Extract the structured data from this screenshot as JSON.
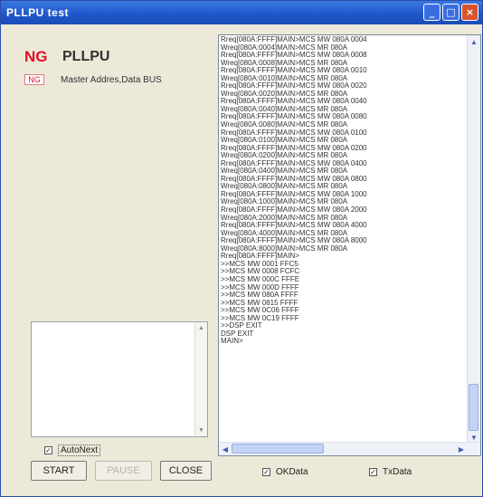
{
  "window": {
    "title": "PLLPU test",
    "controls": {
      "minimize": "_",
      "maximize": "□",
      "close": "×"
    }
  },
  "status": {
    "main_result": "NG",
    "main_title": "PLLPU",
    "sub_result": "NG",
    "sub_label": "Master Addres,Data BUS"
  },
  "controls": {
    "autonext_label": "AutoNext",
    "autonext_checked": true,
    "start_label": "START",
    "pause_label": "PAUSE",
    "pause_enabled": false,
    "close_label": "CLOSE",
    "okdata_label": "OKData",
    "okdata_checked": true,
    "txdata_label": "TxData",
    "txdata_checked": true
  },
  "log": {
    "lines": [
      "Rreq[080A:FFFF]MAIN>MCS MW 080A 0004",
      "Wreq[080A:0004]MAIN>MCS MR 080A",
      "Rreq[080A:FFFF]MAIN>MCS MW 080A 0008",
      "Wreq[080A:0008]MAIN>MCS MR 080A",
      "Rreq[080A:FFFF]MAIN>MCS MW 080A 0010",
      "Wreq[080A:0010]MAIN>MCS MR 080A",
      "Rreq[080A:FFFF]MAIN>MCS MW 080A 0020",
      "Wreq[080A:0020]MAIN>MCS MR 080A",
      "Rreq[080A:FFFF]MAIN>MCS MW 080A 0040",
      "Wreq[080A:0040]MAIN>MCS MR 080A",
      "Rreq[080A:FFFF]MAIN>MCS MW 080A 0080",
      "Wreq[080A:0080]MAIN>MCS MR 080A",
      "Rreq[080A:FFFF]MAIN>MCS MW 080A 0100",
      "Wreq[080A:0100]MAIN>MCS MR 080A",
      "Rreq[080A:FFFF]MAIN>MCS MW 080A 0200",
      "Wreq[080A:0200]MAIN>MCS MR 080A",
      "Rreq[080A:FFFF]MAIN>MCS MW 080A 0400",
      "Wreq[080A:0400]MAIN>MCS MR 080A",
      "Rreq[080A:FFFF]MAIN>MCS MW 080A 0800",
      "Wreq[080A:0800]MAIN>MCS MR 080A",
      "Rreq[080A:FFFF]MAIN>MCS MW 080A 1000",
      "Wreq[080A:1000]MAIN>MCS MR 080A",
      "Rreq[080A:FFFF]MAIN>MCS MW 080A 2000",
      "Wreq[080A:2000]MAIN>MCS MR 080A",
      "Rreq[080A:FFFF]MAIN>MCS MW 080A 4000",
      "Wreq[080A:4000]MAIN>MCS MR 080A",
      "Rreq[080A:FFFF]MAIN>MCS MW 080A 8000",
      "Wreq[080A:8000]MAIN>MCS MR 080A",
      "Rreq[080A:FFFF]MAIN>",
      ">>MCS MW 0001 FFC5",
      ">>MCS MW 0008 FCFC",
      ">>MCS MW 000C FFFE",
      ">>MCS MW 000D FFFF",
      ">>MCS MW 080A FFFF",
      ">>MCS MW 0815 FFFF",
      ">>MCS MW 0C06 FFFF",
      ">>MCS MW 0C19 FFFF",
      ">>DSP EXIT",
      "DSP EXIT",
      "MAIN>"
    ]
  }
}
